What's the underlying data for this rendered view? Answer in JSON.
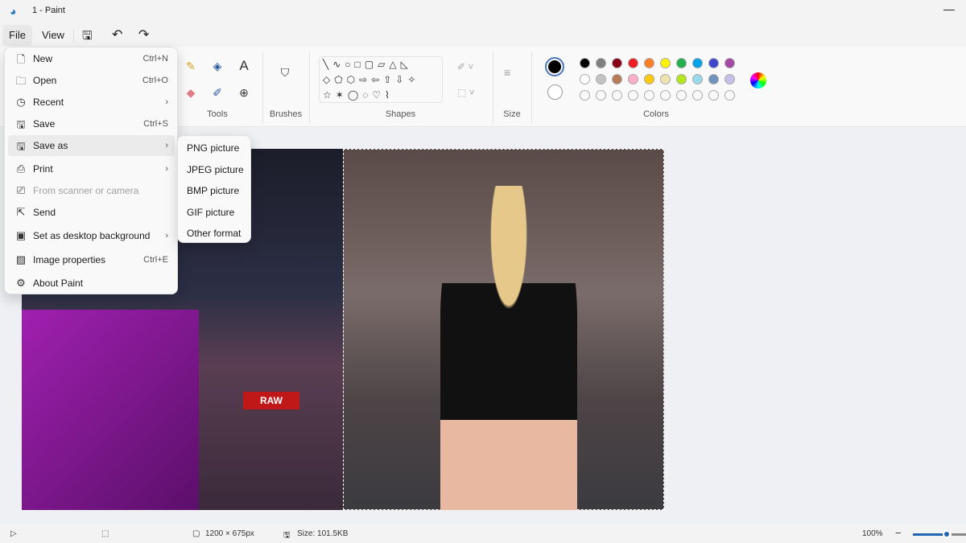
{
  "title": "1 - Paint",
  "menubar": {
    "file": "File",
    "view": "View"
  },
  "ribbon": {
    "tools_label": "Tools",
    "brushes_label": "Brushes",
    "shapes_label": "Shapes",
    "size_label": "Size",
    "colors_label": "Colors",
    "primary_color": "#000000",
    "secondary_color": "#ffffff",
    "palette": [
      [
        "#000000",
        "#7f7f7f",
        "#880015",
        "#ed1c24",
        "#ff7f27",
        "#fff200",
        "#22b14c",
        "#00a2e8",
        "#3f48cc",
        "#a349a4"
      ],
      [
        "#ffffff",
        "#c3c3c3",
        "#b97a57",
        "#ffaec9",
        "#ffc90e",
        "#efe4b0",
        "#b5e61d",
        "#99d9ea",
        "#7092be",
        "#c8bfe7"
      ]
    ]
  },
  "file_menu": {
    "items": [
      {
        "label": "New",
        "shortcut": "Ctrl+N",
        "icon": "new-file-icon"
      },
      {
        "label": "Open",
        "shortcut": "Ctrl+O",
        "icon": "folder-icon"
      },
      {
        "label": "Recent",
        "shortcut": "›",
        "icon": "clock-icon"
      },
      {
        "label": "Save",
        "shortcut": "Ctrl+S",
        "icon": "save-icon"
      },
      {
        "label": "Save as",
        "shortcut": "›",
        "icon": "save-as-icon"
      },
      {
        "label": "Print",
        "shortcut": "›",
        "icon": "printer-icon"
      },
      {
        "label": "From scanner or camera",
        "shortcut": "",
        "icon": "scanner-icon"
      },
      {
        "label": "Send",
        "shortcut": "",
        "icon": "send-icon"
      },
      {
        "label": "Set as desktop background",
        "shortcut": "›",
        "icon": "desktop-icon"
      },
      {
        "label": "Image properties",
        "shortcut": "Ctrl+E",
        "icon": "image-properties-icon"
      },
      {
        "label": "About Paint",
        "shortcut": "",
        "icon": "gear-icon"
      }
    ]
  },
  "save_as_menu": {
    "items": [
      "PNG picture",
      "JPEG picture",
      "BMP picture",
      "GIF picture",
      "Other format"
    ]
  },
  "canvas": {
    "left_banner": "RAW"
  },
  "status": {
    "dimensions": "1200 × 675px",
    "size": "Size: 101.5KB",
    "zoom": "100%",
    "zoom_level_percent": 100
  }
}
